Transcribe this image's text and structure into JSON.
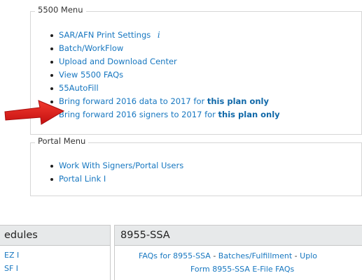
{
  "menu_5500": {
    "legend": "5500 Menu",
    "items": [
      {
        "label": "SAR/AFN Print Settings",
        "icon": "info-icon",
        "icon_glyph": "i"
      },
      {
        "label": "Batch/WorkFlow"
      },
      {
        "label": "Upload and Download Center"
      },
      {
        "label": "View 5500 FAQs"
      },
      {
        "label": "55AutoFill"
      },
      {
        "label": "Bring forward 2016 data to 2017 for ",
        "bold": "this plan only"
      },
      {
        "label": "Bring forward 2016 signers to 2017 for ",
        "bold": "this plan only"
      }
    ]
  },
  "portal_menu": {
    "legend": "Portal Menu",
    "items": [
      {
        "label": "Work With Signers/Portal Users"
      },
      {
        "label": "Portal Link I"
      }
    ]
  },
  "schedules_panel": {
    "title": "edules",
    "items": [
      "EZ I",
      "SF I"
    ]
  },
  "ssa_panel": {
    "title": "8955-SSA",
    "line1_a": "FAQs for 8955-SSA",
    "sep1": " - ",
    "line1_b": "Batches/Fulfillment",
    "sep2": " - ",
    "line1_c": "Uplo",
    "line2": "Form 8955-SSA E-File FAQs"
  },
  "colors": {
    "link": "#1777c0",
    "arrow": "#e01b1b",
    "panel_header_bg": "#e7e9ea"
  },
  "annotations": {
    "arrow_icon": "red-arrow-icon"
  }
}
